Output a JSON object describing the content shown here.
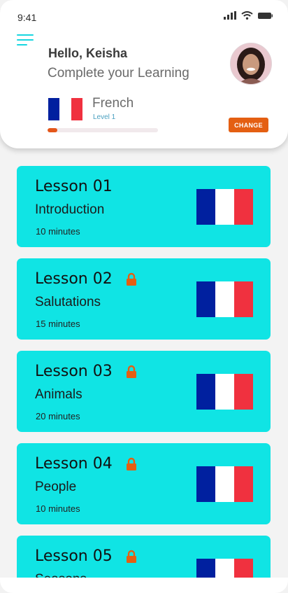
{
  "status": {
    "time": "9:41"
  },
  "header": {
    "greeting": "Hello, Keisha",
    "subtitle": "Complete your Learning",
    "language": "French",
    "level": "Level 1",
    "progress": 0.09,
    "change_label": "CHANGE"
  },
  "lessons": [
    {
      "title": "Lesson 01",
      "subtitle": "Introduction",
      "duration": "10 minutes",
      "locked": false
    },
    {
      "title": "Lesson 02",
      "subtitle": "Salutations",
      "duration": "15 minutes",
      "locked": true
    },
    {
      "title": "Lesson 03",
      "subtitle": "Animals",
      "duration": "20 minutes",
      "locked": true
    },
    {
      "title": "Lesson 04",
      "subtitle": "People",
      "duration": "10 minutes",
      "locked": true
    },
    {
      "title": "Lesson 05",
      "subtitle": "Seasons",
      "duration": "",
      "locked": true
    }
  ],
  "colors": {
    "accent": "#10e4e4",
    "orange": "#e45f12",
    "flag_blue": "#00209f",
    "flag_red": "#f0313f"
  },
  "icons": [
    "menu-icon",
    "signal-icon",
    "wifi-icon",
    "battery-icon",
    "lock-icon",
    "french-flag-icon"
  ]
}
